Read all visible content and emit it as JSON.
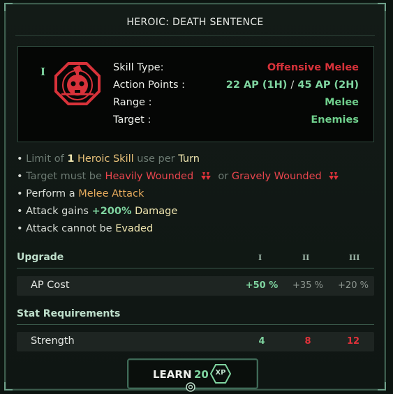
{
  "title": "HEROIC: DEATH SENTENCE",
  "skill": {
    "tier_mark": "I",
    "emblem_icon": "skull-target-icon",
    "stats": {
      "type_label": "Skill Type:",
      "type_value": "Offensive Melee",
      "ap_label": "Action Points :",
      "ap_1h": "22 AP",
      "ap_1h_note": "(1H)",
      "ap_sep": "/",
      "ap_2h": "45 AP",
      "ap_2h_note": "(2H)",
      "range_label": "Range :",
      "range_value": "Melee",
      "target_label": "Target :",
      "target_value": "Enemies"
    }
  },
  "effects": {
    "line1": {
      "a": "Limit of",
      "b": "1",
      "c": "Heroic Skill",
      "d": "use per",
      "e": "Turn"
    },
    "line2": {
      "a": "Target must be",
      "b": "Heavily Wounded",
      "c": "or",
      "d": "Gravely Wounded"
    },
    "line3": {
      "a": "Perform a",
      "b": "Melee Attack"
    },
    "line4": {
      "a": "Attack gains",
      "b": "+200%",
      "c": "Damage"
    },
    "line5": {
      "a": "Attack cannot be",
      "b": "Evaded"
    }
  },
  "upgrade": {
    "header": "Upgrade",
    "tiers": [
      "I",
      "II",
      "III"
    ],
    "row_label": "AP Cost",
    "values": [
      "+50 %",
      "+35 %",
      "+20 %"
    ]
  },
  "requirements": {
    "header": "Stat Requirements",
    "row_label": "Strength",
    "values": [
      "4",
      "8",
      "12"
    ]
  },
  "learn": {
    "label": "LEARN",
    "cost": "20",
    "currency": "XP"
  },
  "colors": {
    "accent_green": "#7fd4a0",
    "danger_red": "#d8323a",
    "gold": "#e9c27a",
    "frame": "#3b5a4b"
  }
}
